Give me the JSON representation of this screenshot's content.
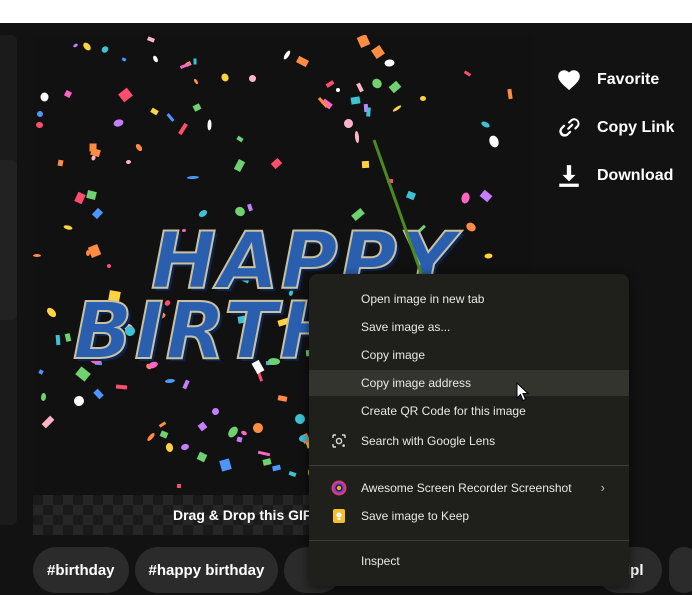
{
  "gif": {
    "headline_line1": "HAPPY",
    "headline_line2": "BIRTH",
    "drag_label": "Drag & Drop this GIF"
  },
  "actions": [
    {
      "label": "Favorite",
      "icon": "heart-icon"
    },
    {
      "label": "Copy Link",
      "icon": "link-icon"
    },
    {
      "label": "Download",
      "icon": "download-icon"
    }
  ],
  "tags": [
    "#birthday",
    "#happy birthday"
  ],
  "tag_right": "ipl",
  "context_menu": {
    "items": [
      {
        "label": "Open image in new tab"
      },
      {
        "label": "Save image as..."
      },
      {
        "label": "Copy image"
      },
      {
        "label": "Copy image address",
        "highlighted": true
      },
      {
        "label": "Create QR Code for this image"
      },
      {
        "label": "Search with Google Lens",
        "icon": "google-lens-icon"
      },
      {
        "label": "Awesome Screen Recorder  Screenshot",
        "icon": "awesome-screenshot-icon",
        "submenu": true
      },
      {
        "label": "Save image to Keep",
        "icon": "google-keep-icon"
      },
      {
        "label": "Inspect"
      }
    ],
    "submenu_glyph": "›"
  },
  "colors": {
    "background": "#121212",
    "menu_background": "#1f1f1b",
    "menu_highlight": "#34342f",
    "arrow_annotation": "#4a8a1f",
    "headline_fill": "#2a5fb0"
  }
}
